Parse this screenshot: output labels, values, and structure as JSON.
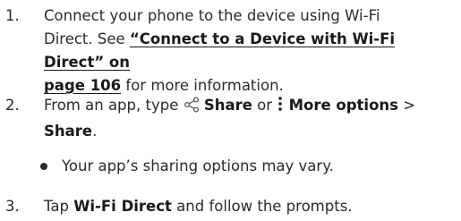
{
  "steps": [
    {
      "number": "1.",
      "line1": "Connect your phone to the device using Wi-Fi",
      "line2_pre": "Direct. See ",
      "link_part1": "“Connect to a Device with Wi-Fi Direct” on",
      "link_part2": "page 106",
      "line3_post": " for more information."
    },
    {
      "number": "2.",
      "pre": "From an app, type ",
      "share_icon": "share-icon",
      "share_label": "Share",
      "or": " or ",
      "more_icon": "more-options-icon",
      "more_label": "More options",
      "sep": " >",
      "share_label2": "Share",
      "period": "."
    },
    {
      "number": "3.",
      "pre": "Tap ",
      "bold": "Wi-Fi Direct",
      "post": " and follow the prompts."
    }
  ],
  "bullet": {
    "text": "Your app’s sharing options may vary."
  }
}
